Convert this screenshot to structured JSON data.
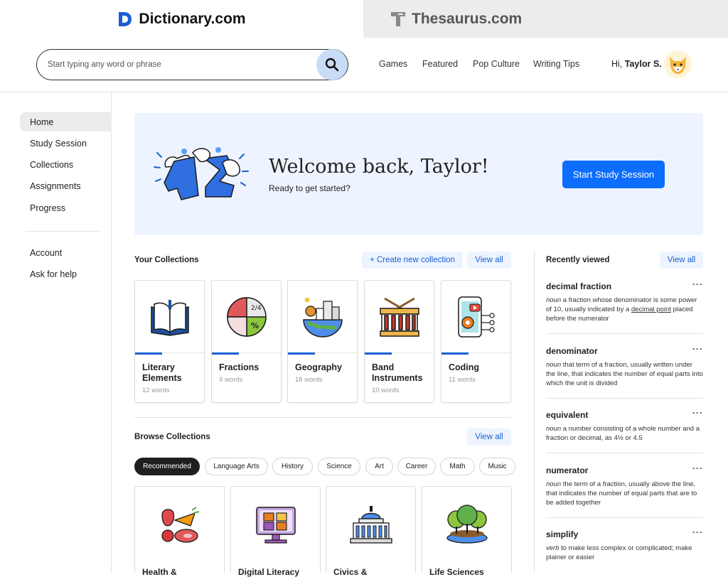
{
  "brand": {
    "dictionary": "Dictionary.com",
    "thesaurus": "Thesaurus.com",
    "accent": "#0d6efd"
  },
  "search": {
    "placeholder": "Start typing any word or phrase",
    "value": ""
  },
  "nav": {
    "items": [
      "Games",
      "Featured",
      "Pop Culture",
      "Writing Tips"
    ],
    "greeting": "Hi,",
    "user": "Taylor S."
  },
  "sidebar": {
    "items": [
      "Home",
      "Study Session",
      "Collections",
      "Assignments",
      "Progress"
    ],
    "secondary": [
      "Account",
      "Ask for help"
    ],
    "active": "Home"
  },
  "hero": {
    "title": "Welcome back, Taylor!",
    "subtitle": "Ready to get started?",
    "button": "Start Study Session"
  },
  "collections": {
    "title": "Your Collections",
    "create": "+ Create new collection",
    "view_all": "View all",
    "items": [
      {
        "name": "Literary Elements",
        "count": "12 words",
        "icon": "book-icon"
      },
      {
        "name": "Fractions",
        "count": "9 words",
        "icon": "fraction-pie-icon"
      },
      {
        "name": "Geography",
        "count": "18 words",
        "icon": "globe-city-icon"
      },
      {
        "name": "Band Instruments",
        "count": "10 words",
        "icon": "drum-icon"
      },
      {
        "name": "Coding",
        "count": "11 words",
        "icon": "phone-code-icon"
      }
    ]
  },
  "browse": {
    "title": "Browse Collections",
    "view_all": "View all",
    "filters": [
      "Recommended",
      "Language Arts",
      "History",
      "Science",
      "Art",
      "Career",
      "Math",
      "Music"
    ],
    "active_filter": "Recommended",
    "items": [
      {
        "name": "Health &",
        "icon": "food-icon"
      },
      {
        "name": "Digital Literacy",
        "icon": "computer-icon"
      },
      {
        "name": "Civics &",
        "icon": "capitol-icon"
      },
      {
        "name": "Life Sciences",
        "icon": "trees-icon"
      }
    ]
  },
  "recent": {
    "title": "Recently viewed",
    "view_all": "View all",
    "items": [
      {
        "word": "decimal fraction",
        "pos": "noun",
        "def_a": " a fraction whose denominator is some power of 10, usually indicated by a ",
        "link": "decimal point",
        "def_b": " placed before the numerator"
      },
      {
        "word": "denominator",
        "pos": "noun",
        "def_a": " that term of a fraction, usually written under the line, that indicates the number of equal parts into which the unit is divided",
        "link": "",
        "def_b": ""
      },
      {
        "word": "equivalent",
        "pos": "noun",
        "def_a": " a number consisting of a whole number and a fraction or decimal, as 4½ or 4.5",
        "link": "",
        "def_b": ""
      },
      {
        "word": "numerator",
        "pos": "noun",
        "def_a": " the term of a fraction, usually above the line, that indicates the number of equal parts that are to be added together",
        "link": "",
        "def_b": ""
      },
      {
        "word": "simplify",
        "pos": "verb",
        "def_a": " to make less complex or complicated; make plainer or easier",
        "link": "",
        "def_b": ""
      }
    ]
  }
}
